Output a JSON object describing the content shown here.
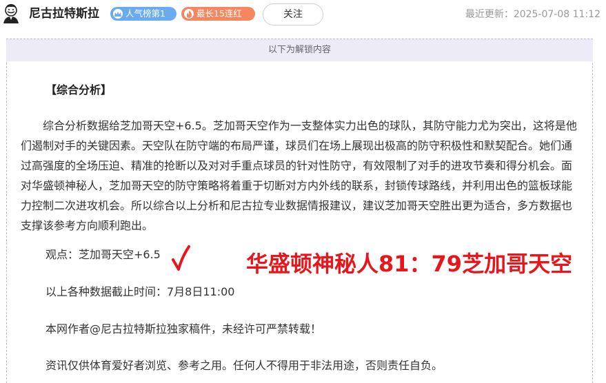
{
  "header": {
    "author_name": "尼古拉特斯拉",
    "badges": [
      {
        "label": "人气榜第1",
        "icon": "crown-icon",
        "color": "#6aaaf0"
      },
      {
        "label": "最长15连红",
        "icon": "fire-icon",
        "color": "#f5865f"
      }
    ],
    "follow_label": "关注",
    "last_update": "最近更新：2025-07-08 11:12"
  },
  "unlock": {
    "banner": "以下为解锁内容"
  },
  "article": {
    "section_title": "【综合分析】",
    "analysis": "综合分析数据给芝加哥天空+6.5。芝加哥天空作为一支整体实力出色的球队，其防守能力尤为突出，这将是他们遏制对手的关键因素。天空队在防守端的布局严谨，球员们在场上展现出极高的防守积极性和默契配合。她们通过高强度的全场压迫、精准的抢断以及对对手重点球员的针对性防守，有效限制了对手的进攻节奏和得分机会。面对华盛顿神秘人，芝加哥天空的防守策略将着重于切断对方内外线的联系，封锁传球路线，并利用出色的篮板球能力控制二次进攻机会。所以综合以上分析和尼古拉专业数据情报建议，建议芝加哥天空胜出更为适合，多方数据也支撑该参考方向顺利跑出。",
    "opinion": "观点：芝加哥天空+6.5",
    "result_overlay": "华盛顿神秘人81：79芝加哥天空",
    "cutoff": "以上各种数据截止时间：7月8日11:00",
    "copyright": "本网作者@尼古拉特斯拉独家稿件，未经许可严禁转载！",
    "disclaimer": "资讯仅供体育爱好者浏览、参考之用。任何人不得用于非法用途，否则责任自负。"
  },
  "colors": {
    "result_red": "#e8161b",
    "unlock_bg": "#ecebf6"
  }
}
